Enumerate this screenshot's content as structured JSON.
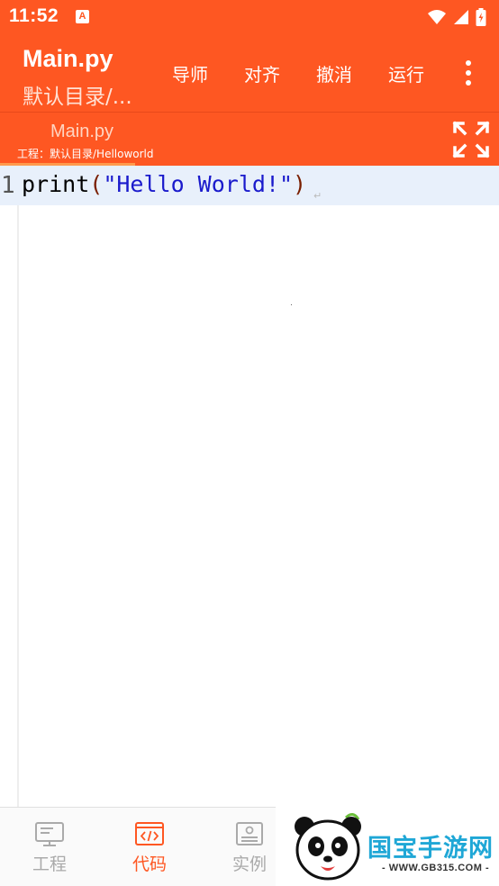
{
  "status_bar": {
    "time": "11:52",
    "app_icon_glyph": "A",
    "icons": [
      "wifi-icon",
      "signal-icon",
      "battery-icon"
    ]
  },
  "app_bar": {
    "title": "Main.py",
    "subtitle": "默认目录/...",
    "menu": {
      "guide": "导师",
      "align": "对齐",
      "undo": "撤消",
      "run": "运行"
    }
  },
  "file_tab": {
    "name": "Main.py",
    "path": "工程：默认目录/Helloworld"
  },
  "editor": {
    "line_number": "1",
    "code": {
      "func": "print",
      "open_paren": "(",
      "string": "\"Hello World!\"",
      "close_paren": ")"
    },
    "eol_mark": "↵"
  },
  "bottom_nav": {
    "project": "工程",
    "code": "代码",
    "examples": "实例"
  },
  "watermark": {
    "logo_text": "国宝手游网",
    "url": "- WWW.GB315.COM -"
  },
  "colors": {
    "primary": "#fe5722",
    "current_line": "#e8f0fb",
    "string": "#1a1acc",
    "nav_inactive": "#aaaaaa"
  }
}
